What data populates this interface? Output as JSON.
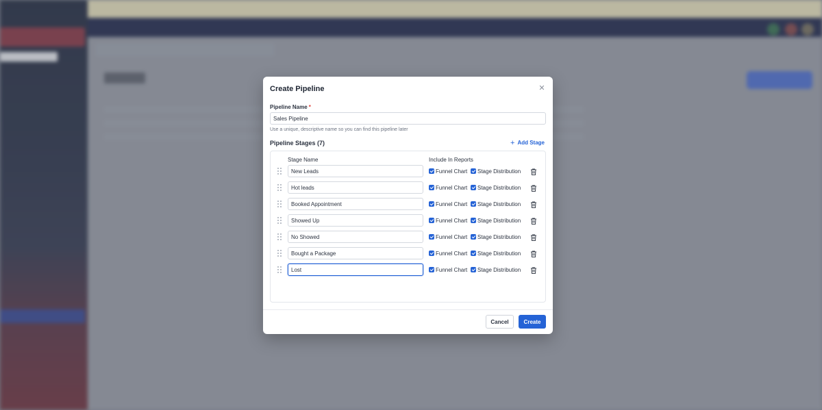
{
  "modal": {
    "title": "Create Pipeline",
    "close_icon": "close-icon",
    "pipeline_name": {
      "label": "Pipeline Name",
      "required_mark": "*",
      "value": "Sales Pipeline",
      "hint": "Use a unique, descriptive name so you can find this pipeline later"
    },
    "stages": {
      "title": "Pipeline Stages (7)",
      "add_label": "Add Stage",
      "col_stage_name": "Stage Name",
      "col_include": "Include In Reports",
      "funnel_label": "Funnel Chart",
      "distribution_label": "Stage Distribution",
      "items": [
        {
          "name": "New Leads",
          "funnel": true,
          "distribution": true
        },
        {
          "name": "Hot leads",
          "funnel": true,
          "distribution": true
        },
        {
          "name": "Booked Appointment",
          "funnel": true,
          "distribution": true
        },
        {
          "name": "Showed Up",
          "funnel": true,
          "distribution": true
        },
        {
          "name": "No Showed",
          "funnel": true,
          "distribution": true
        },
        {
          "name": "Bought a Package",
          "funnel": true,
          "distribution": true
        },
        {
          "name": "Lost",
          "funnel": true,
          "distribution": true
        }
      ]
    },
    "footer": {
      "cancel_label": "Cancel",
      "create_label": "Create"
    }
  },
  "colors": {
    "primary": "#2563d6",
    "required": "#e0443e"
  }
}
